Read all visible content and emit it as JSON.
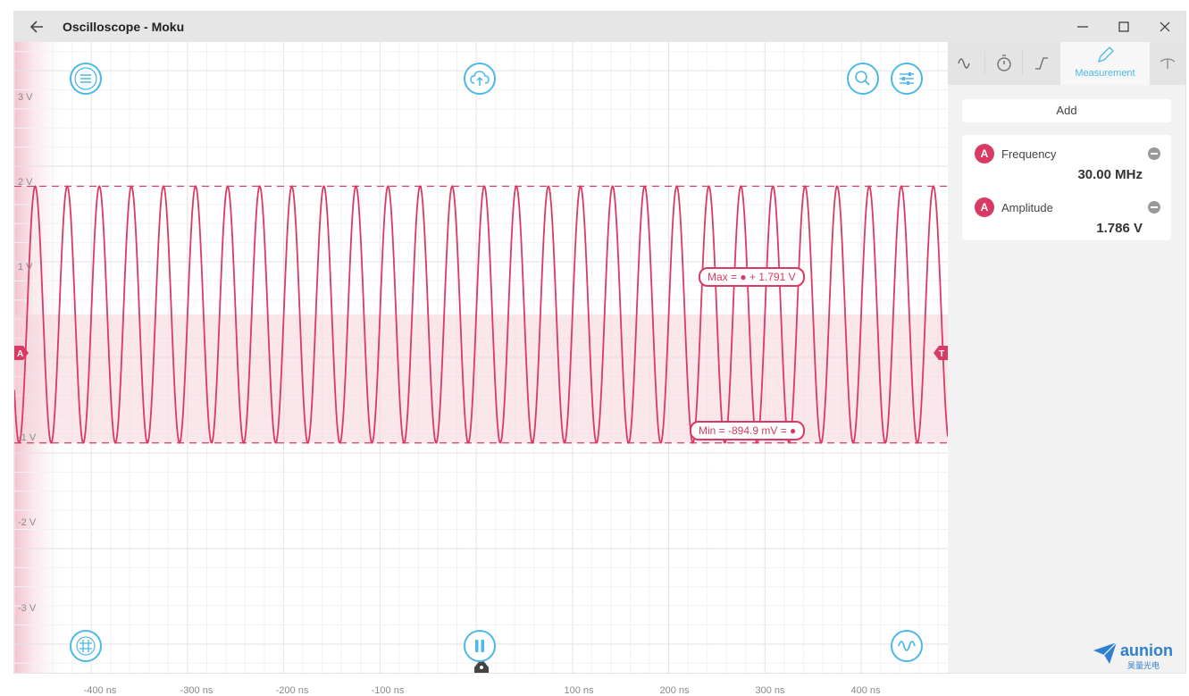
{
  "window": {
    "title": "Oscilloscope - Moku",
    "back_icon": "arrow-left-icon"
  },
  "plot": {
    "y_ticks": [
      "3 V",
      "2 V",
      "1 V",
      "-1 V",
      "-2 V",
      "-3 V"
    ],
    "x_ticks": [
      "-400 ns",
      "-300 ns",
      "-200 ns",
      "-100 ns",
      "100 ns",
      "200 ns",
      "300 ns",
      "400 ns"
    ],
    "channel_marker": "A",
    "trigger_marker": "T",
    "max_label": "Max = ● + 1.791 V",
    "min_label": "Min = -894.9 mV = ●",
    "trace_color": "#d93a63",
    "accent_color": "#4cb8e8"
  },
  "chart_data": {
    "type": "line",
    "title": "",
    "xlabel": "",
    "ylabel": "",
    "xlim_ns": [
      -480,
      490
    ],
    "ylim_v": [
      -3.3,
      3.3
    ],
    "series": [
      {
        "frequency_mhz": 30.0,
        "max_v": 1.791,
        "min_v": -0.8949,
        "offset_v": 0.0
      }
    ]
  },
  "sidebar": {
    "tabs": [
      {
        "icon": "sine-wave-icon",
        "label": ""
      },
      {
        "icon": "stopwatch-icon",
        "label": ""
      },
      {
        "icon": "trigger-edge-icon",
        "label": ""
      },
      {
        "icon": "pencil-icon",
        "label": "Measurement"
      },
      {
        "icon": "probe-icon",
        "label": ""
      }
    ],
    "add_label": "Add",
    "measurements": [
      {
        "channel": "A",
        "name": "Frequency",
        "value": "30.00 MHz"
      },
      {
        "channel": "A",
        "name": "Amplitude",
        "value": "1.786 V"
      }
    ]
  },
  "brand": {
    "name": "aunion",
    "sub": "昊量光电"
  }
}
